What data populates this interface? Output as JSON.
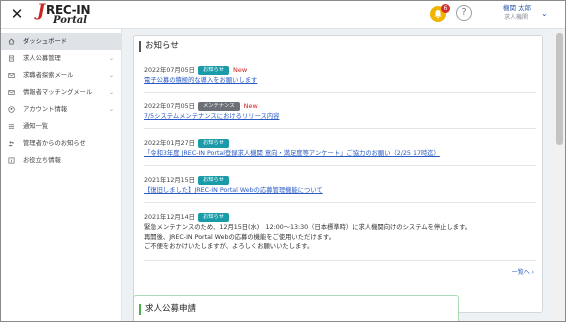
{
  "header": {
    "logo_j": "J",
    "logo_rec": "REC-IN",
    "logo_portal": "Portal",
    "bell_count": "6",
    "help_symbol": "?",
    "user_name": "機関 太郎",
    "user_role": "求人機関"
  },
  "sidebar": {
    "items": [
      {
        "label": "ダッシュボード",
        "icon": "home-icon",
        "active": true
      },
      {
        "label": "求人公募管理",
        "icon": "document-icon",
        "chevron": true
      },
      {
        "label": "求職者探索メール",
        "icon": "mail-icon",
        "chevron": true
      },
      {
        "label": "情報者マッチングメール",
        "icon": "mail-icon",
        "chevron": true
      },
      {
        "label": "アカウント情報",
        "icon": "user-icon",
        "chevron": true
      },
      {
        "label": "通知一覧",
        "icon": "list-icon"
      },
      {
        "label": "管理者からのお知らせ",
        "icon": "people-icon"
      },
      {
        "label": "お役立ち情報",
        "icon": "info-icon"
      }
    ]
  },
  "notice": {
    "title": "お知らせ",
    "items": [
      {
        "date": "2022年07月05日",
        "badge": "お知らせ",
        "badge_color": "#199ba8",
        "new_label": "New",
        "link": "電子公募の積極的な導入をお願いします"
      },
      {
        "date": "2022年07月05日",
        "badge": "メンテナンス",
        "badge_color": "#6b7177",
        "new_label": "New",
        "link": "7/5システムメンテナンスにおけるリリース内容"
      },
      {
        "date": "2022年01月27日",
        "badge": "お知らせ",
        "badge_color": "#199ba8",
        "link": "「令和3年度 JREC-IN Portal登録求人機関 意向・満足度等アンケート」ご協力のお願い（2/25 17時迄）"
      },
      {
        "date": "2021年12月15日",
        "badge": "お知らせ",
        "badge_color": "#199ba8",
        "link": "【復旧しました】JREC-IN Portal Webの応募管理機能について"
      },
      {
        "date": "2021年12月14日",
        "badge": "お知らせ",
        "badge_color": "#199ba8",
        "body": [
          "緊急メンテナンスのため、12月15日(水)　12:00～13:30（日本標準時）に求人機関向けのシステムを停止します。",
          "再開後、JREC-IN Portal Webの応募の機能をご使用いただけます。",
          "ご不便をおかけいたしますが、よろしくお願いいたします。"
        ]
      }
    ],
    "more": "一覧へ ›"
  },
  "job_card": {
    "title": "求人公募申請"
  },
  "colors": {
    "accent": "#199ba8",
    "link": "#2a5ac4",
    "new": "#d21e1e",
    "brand": "#c62828"
  }
}
